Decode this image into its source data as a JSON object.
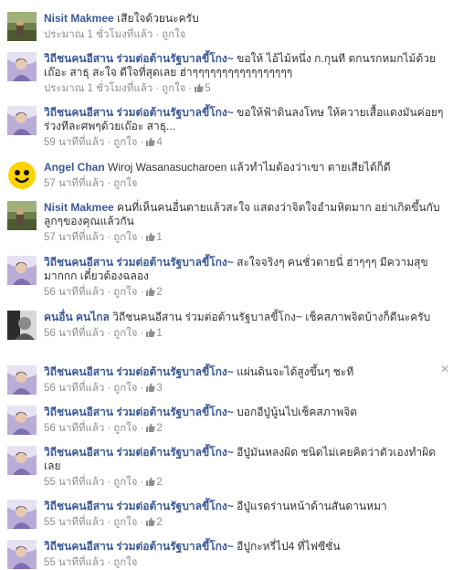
{
  "close_label": "×",
  "ui": {
    "like_label": "ถูกใจ"
  },
  "comments": [
    {
      "avatar": "landscape",
      "author": "Nisit Makmee",
      "text": "เสียใจด้วยนะครับ",
      "time": "ประมาณ 1 ชั่วโมงที่แล้ว",
      "likes": ""
    },
    {
      "avatar": "portrait",
      "author": "วิถีชนคนอีสาน ร่วมต่อต้านรัฐบาลขี้โกง~",
      "text": "ขอให้ ไอ้ไม้หนึ่ง ก.กุนที ตกนรกหมกไม้ด้วยเถ๊อะ สาธุ สะใจ ดีใจที่สุดเลย ฮ่าๆๆๆๆๆๆๆๆๆๆๆๆๆๆๆๆๆ",
      "time": "ประมาณ 1 ชั่วโมงที่แล้ว",
      "likes": "5"
    },
    {
      "avatar": "portrait",
      "author": "วิถีชนคนอีสาน ร่วมต่อต้านรัฐบาลขี้โกง~",
      "text": "ขอให้ฟ้าดินลงโทษ ให้ควายเสื้อแดงมันค่อยๆร่วงทีละศพๆด้วยเถ๊อะ สาธุ...",
      "time": "59 นาทีที่แล้ว",
      "likes": "4"
    },
    {
      "avatar": "smiley",
      "author": "Angel Chan",
      "text": "Wiroj Wasanasucharoen แล้วทำไมต้องว่าเขา ตายเสียได้ก็ดี",
      "time": "57 นาทีที่แล้ว",
      "likes": ""
    },
    {
      "avatar": "landscape",
      "author": "Nisit Makmee",
      "text": "คนที่เห็นคนอื่นตายแล้วสะใจ แสดงว่าจิตใจอำมหิตมาก อย่าเกิดขึ้นกับลูกๆของคุณแล้วกัน",
      "time": "57 นาทีที่แล้ว",
      "likes": "1"
    },
    {
      "avatar": "portrait",
      "author": "วิถีชนคนอีสาน ร่วมต่อต้านรัฐบาลขี้โกง~",
      "text": "สะใจจริงๆ คนชั่วตายนี่ ฮ่าๆๆๆ มีความสุขมากกก เดี๋ยวต้องฉลอง",
      "time": "56 นาทีที่แล้ว",
      "likes": "2"
    },
    {
      "avatar": "bw",
      "author": "คนอื่น คนไกล",
      "text": "วิถีชนคนอีสาน ร่วมต่อต้านรัฐบาลขี้โกง~ เช็คสภาพจิตบ้างก็ดีนะครับ",
      "time": "56 นาทีที่แล้ว",
      "likes": "1"
    },
    {
      "avatar": "portrait",
      "author": "วิถีชนคนอีสาน ร่วมต่อต้านรัฐบาลขี้โกง~",
      "text": "แผ่นดินจะได้สูงขึ้นๆ ชะที",
      "time": "56 นาทีที่แล้ว",
      "likes": "3"
    },
    {
      "avatar": "portrait",
      "author": "วิถีชนคนอีสาน ร่วมต่อต้านรัฐบาลขี้โกง~",
      "text": "บอกอีปู่นู้นไปเช็คสภาพจิต",
      "time": "56 นาทีที่แล้ว",
      "likes": "2"
    },
    {
      "avatar": "portrait",
      "author": "วิถีชนคนอีสาน ร่วมต่อต้านรัฐบาลขี้โกง~",
      "text": "อีปู่มันหลงผิด ชนิดไม่เคยคิดว่าตัวเองทำผิดเลย",
      "time": "55 นาทีที่แล้ว",
      "likes": "2"
    },
    {
      "avatar": "portrait",
      "author": "วิถีชนคนอีสาน ร่วมต่อต้านรัฐบาลขี้โกง~",
      "text": "อีปู่แรดร่านหน้าด้านสันดานหมา",
      "time": "55 นาทีที่แล้ว",
      "likes": "2"
    },
    {
      "avatar": "portrait",
      "author": "วิถีชนคนอีสาน ร่วมต่อต้านรัฐบาลขี้โกง~",
      "text": "อีปูกะหรี่ไป4 ที่ไฟซีซั่น",
      "time": "55 นาทีที่แล้ว",
      "likes": ""
    }
  ]
}
